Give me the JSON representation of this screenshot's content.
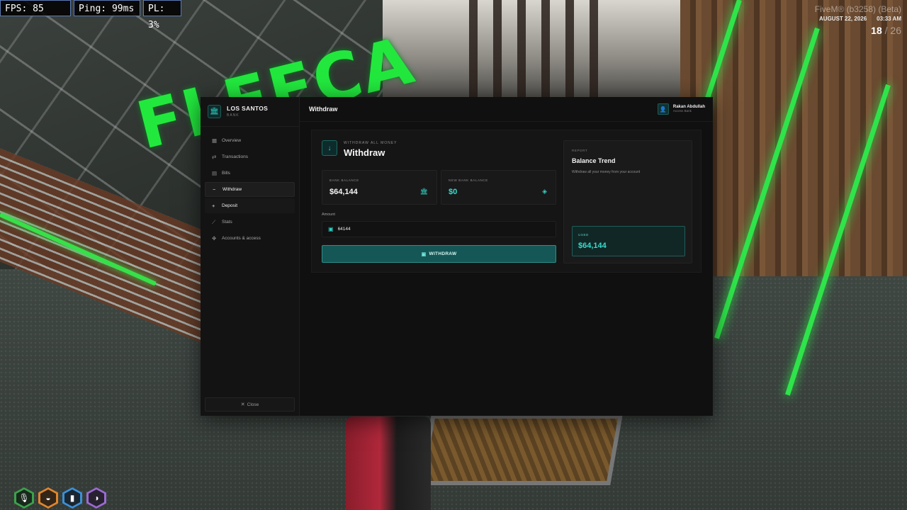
{
  "hud": {
    "fps": "FPS: 85",
    "ping": "Ping: 99ms",
    "pl": "PL: 3%",
    "watermark": "FiveM® (b3258) (Beta)",
    "date": "AUGUST 22, 2026",
    "time": "03:33 AM",
    "players": "18",
    "players_max": "/ 26"
  },
  "world": {
    "sign_text": "FLEECA"
  },
  "bank": {
    "brand_name": "LOS SANTOS",
    "brand_sub": "BANK",
    "nav": [
      {
        "label": "Overview",
        "icon": "grid-icon",
        "glyph": "▦"
      },
      {
        "label": "Transactions",
        "icon": "transfer-icon",
        "glyph": "⇄"
      },
      {
        "label": "Bills",
        "icon": "document-icon",
        "glyph": "▤"
      },
      {
        "label": "Withdraw",
        "icon": "minus-icon",
        "glyph": "−"
      },
      {
        "label": "Deposit",
        "icon": "plus-icon",
        "glyph": "+"
      },
      {
        "label": "Stats",
        "icon": "chart-icon",
        "glyph": "⟋"
      },
      {
        "label": "Accounts & access",
        "icon": "handshake-icon",
        "glyph": "✥"
      }
    ],
    "close_label": "Close",
    "page_title": "Withdraw",
    "user": {
      "name": "Rakan Abdullah",
      "role": "Access Bank"
    },
    "withdraw": {
      "kicker": "WITHDRAW ALL MONEY",
      "title": "Withdraw",
      "bank_balance_label": "BANK BALANCE",
      "bank_balance_value": "$64,144",
      "new_balance_label": "NEW BANK BALANCE",
      "new_balance_value": "$0",
      "amount_label": "Amount",
      "amount_value": "64144",
      "button_label": "WITHDRAW"
    },
    "report": {
      "kicker": "REPORT",
      "title": "Balance Trend",
      "description": "Withdraw all your money from your account",
      "used_label": "USED",
      "used_value": "$64,144"
    }
  },
  "colors": {
    "accent": "#2fd3c6",
    "button_bg": "#155756",
    "panel_bg": "#101010",
    "neon_green": "#2fe44a"
  }
}
